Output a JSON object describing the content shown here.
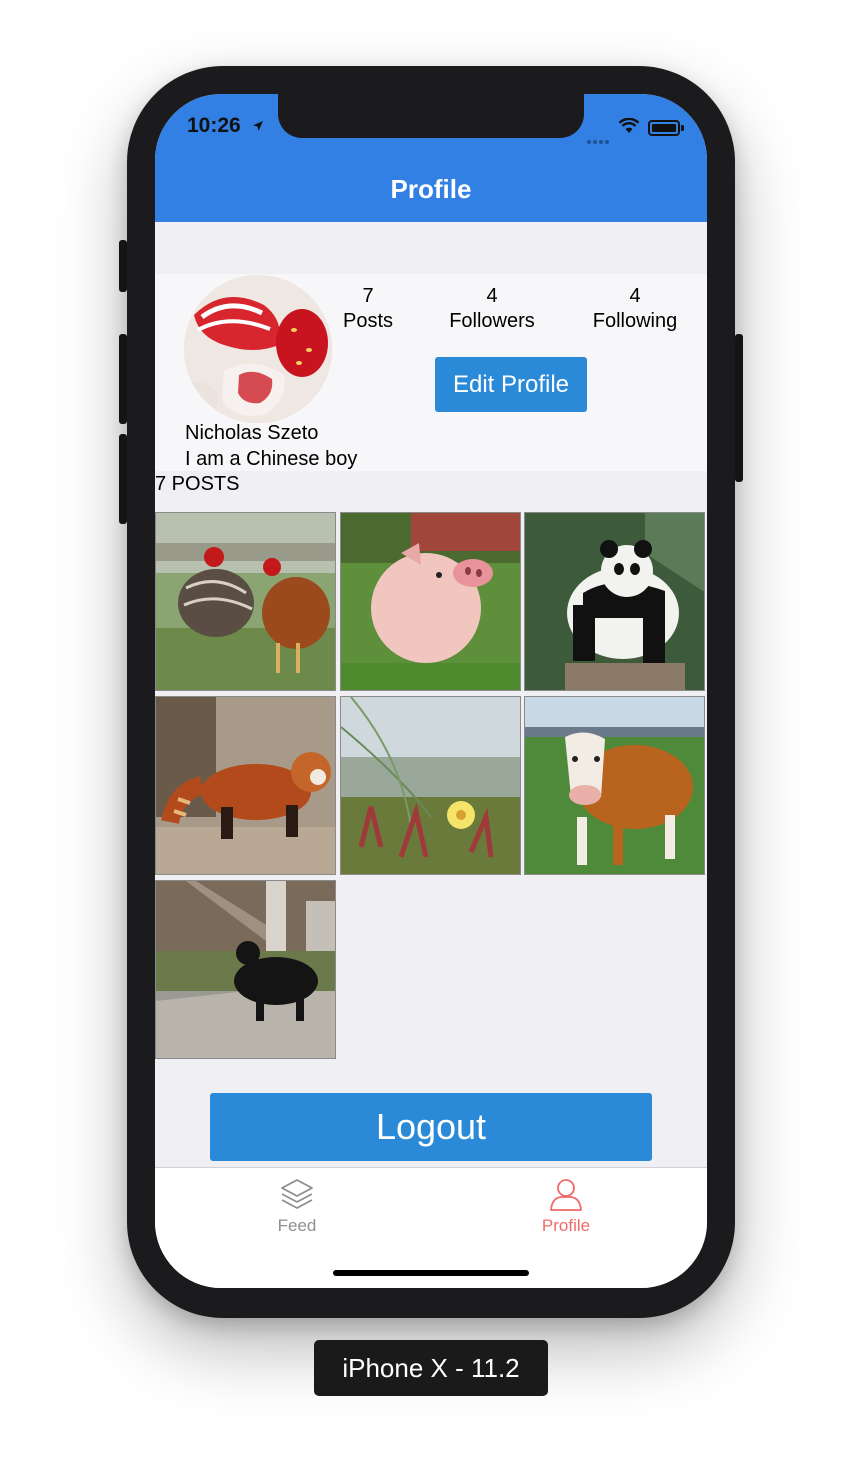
{
  "status_bar": {
    "time": "10:26"
  },
  "nav": {
    "title": "Profile"
  },
  "profile": {
    "name": "Nicholas Szeto",
    "bio": "I am a Chinese boy",
    "stats": [
      {
        "value": "7",
        "label": "Posts"
      },
      {
        "value": "4",
        "label": "Followers"
      },
      {
        "value": "4",
        "label": "Following"
      }
    ],
    "edit_button": "Edit Profile"
  },
  "posts": {
    "count_label": "7 POSTS",
    "items": [
      "chickens",
      "piglet",
      "panda",
      "red panda",
      "flower",
      "cow",
      "cat"
    ]
  },
  "logout_label": "Logout",
  "tabs": [
    {
      "label": "Feed",
      "icon": "layers-icon",
      "active": false
    },
    {
      "label": "Profile",
      "icon": "person-icon",
      "active": true
    }
  ],
  "colors": {
    "nav": "#3280e4",
    "button": "#2b8ad8",
    "active_tab": "#f06a6a",
    "inactive_tab": "#8e8e93"
  },
  "device_label": "iPhone X - 11.2"
}
